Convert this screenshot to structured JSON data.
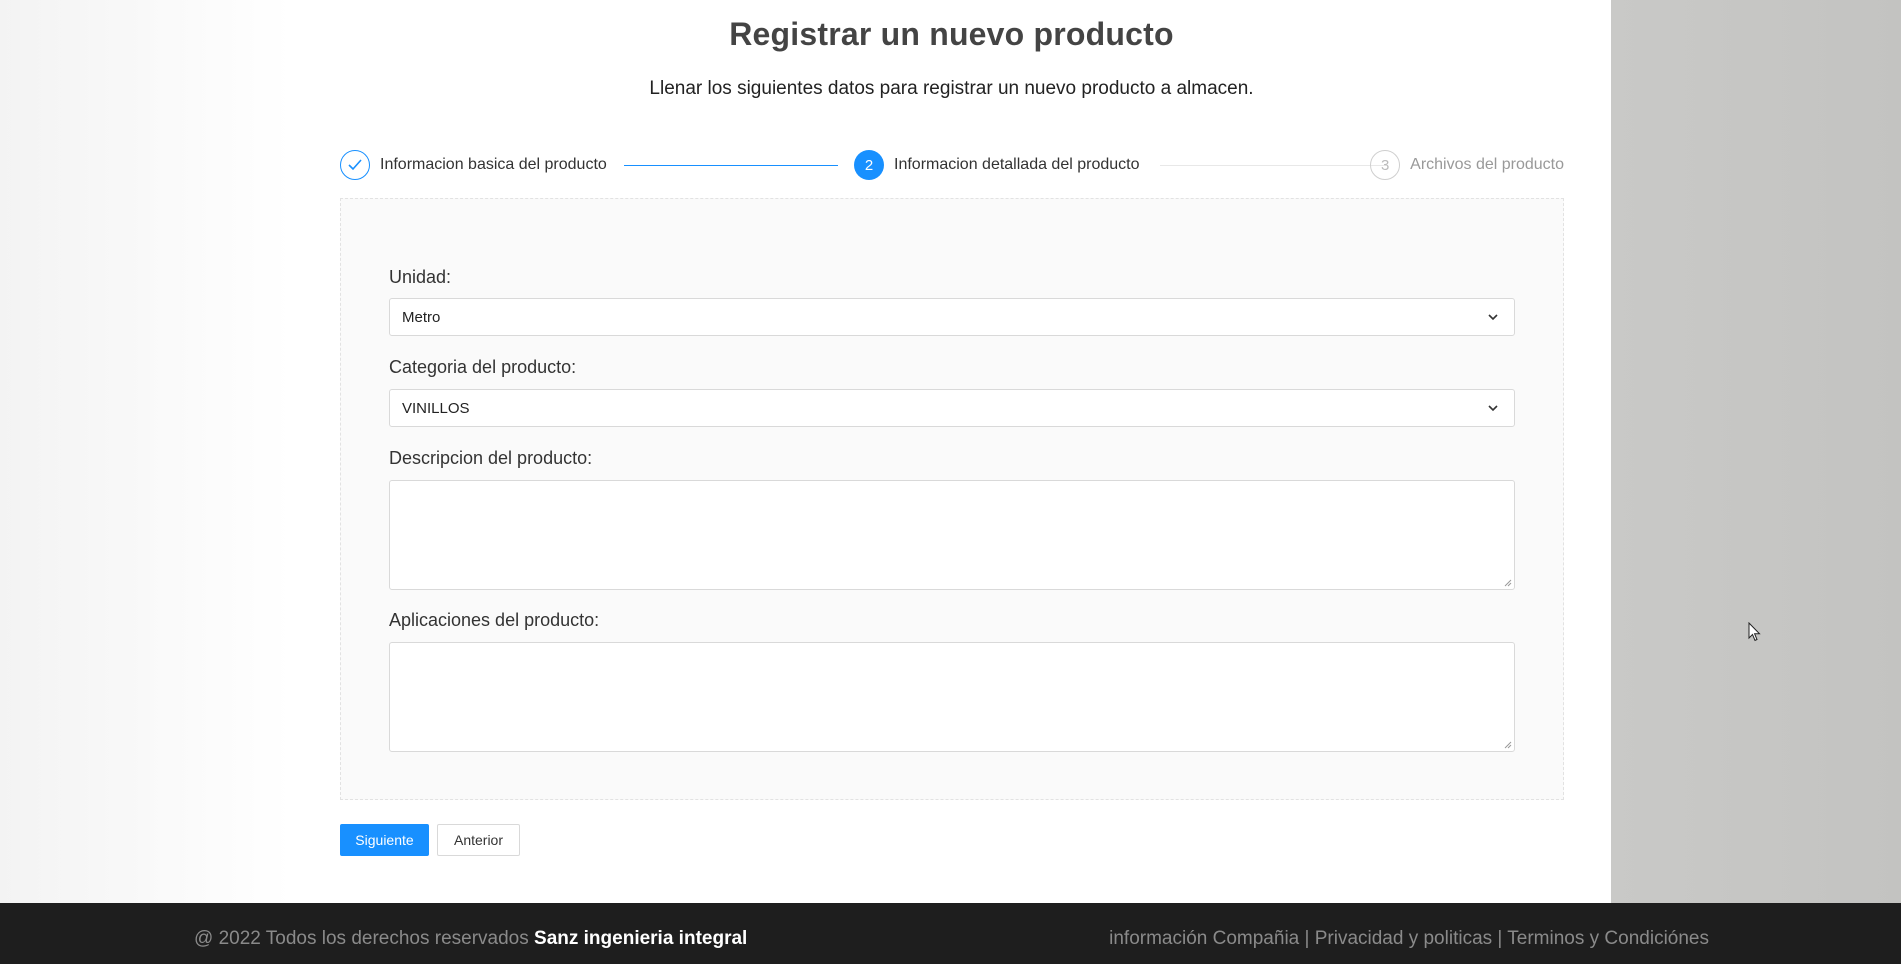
{
  "header": {
    "title": "Registrar un nuevo producto",
    "subtitle": "Llenar los siguientes datos para registrar un nuevo producto a almacen."
  },
  "stepper": {
    "steps": [
      {
        "number": "1",
        "label": "Informacion basica del producto",
        "status": "done"
      },
      {
        "number": "2",
        "label": "Informacion detallada del producto",
        "status": "active"
      },
      {
        "number": "3",
        "label": "Archivos del producto",
        "status": "pending"
      }
    ]
  },
  "form": {
    "unidad": {
      "label": "Unidad:",
      "value": "Metro"
    },
    "categoria": {
      "label": "Categoria del producto:",
      "value": "VINILLOS"
    },
    "descripcion": {
      "label": "Descripcion del producto:",
      "value": ""
    },
    "aplicaciones": {
      "label": "Aplicaciones del producto:",
      "value": ""
    }
  },
  "buttons": {
    "next": "Siguiente",
    "prev": "Anterior"
  },
  "footer": {
    "copyright": "@ 2022 Todos los derechos reservados",
    "brand": "Sanz ingenieria integral",
    "links": "información Compañia | Privacidad y politicas | Terminos y Condiciónes"
  },
  "colors": {
    "accent": "#1890ff",
    "footer_bg": "#1e1e1e"
  },
  "icons": {
    "step1": "check-icon",
    "select": "chevron-down-icon",
    "cursor": "mouse-pointer-icon"
  }
}
